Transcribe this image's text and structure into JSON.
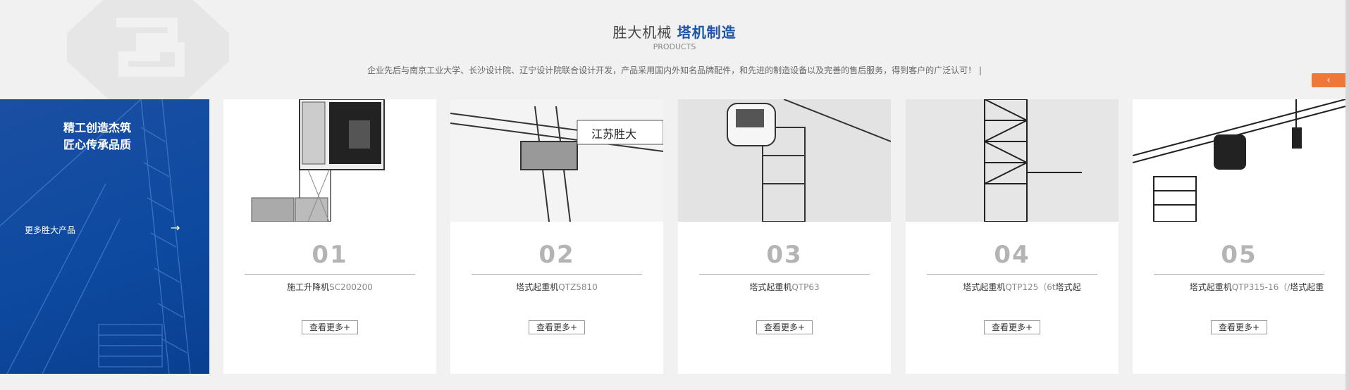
{
  "header": {
    "title_plain": "胜大机械",
    "title_accent": "塔机制造",
    "subtitle": "PRODUCTS",
    "description": "企业先后与南京工业大学、长沙设计院、辽宁设计院联合设计开发，产品采用国内外知名品牌配件，和先进的制造设备以及完善的售后服务，得到客户的广泛认可！ |"
  },
  "side_tab": {
    "label": "‹"
  },
  "promo": {
    "slogan_line1": "精工创造杰筑",
    "slogan_line2": "匠心传承品质",
    "more_label": "更多胜大产品",
    "arrow": "→"
  },
  "products": [
    {
      "num": "01",
      "name": "施工升降机",
      "model": "SC200200",
      "more": "查看更多+"
    },
    {
      "num": "02",
      "name": "塔式起重机",
      "model": "QTZ5810",
      "more": "查看更多+"
    },
    {
      "num": "03",
      "name": "塔式起重机",
      "model": "QTP63",
      "more": "查看更多+"
    },
    {
      "num": "04",
      "name": "塔式起重机",
      "model": "QTP125（6t",
      "suffix": "塔式起",
      "more": "查看更多+"
    },
    {
      "num": "05",
      "name": "塔式起重机",
      "model": "QTP315-16（/",
      "suffix": "塔式起重",
      "more": "查看更多+"
    }
  ],
  "photo_texts": {
    "crane_sign": "江苏胜大"
  },
  "colors": {
    "brand_blue": "#1d54a6",
    "accent_orange": "#f0773a"
  }
}
